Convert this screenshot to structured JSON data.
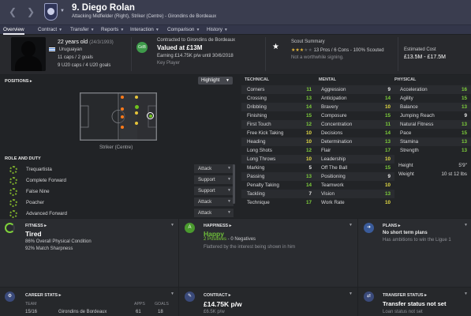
{
  "header": {
    "player_name": "9. Diego Rolan",
    "subtitle": "Attacking Midfielder (Right), Striker (Centre) - Girondins de Bordeaux"
  },
  "tabs": [
    {
      "label": "Overview",
      "active": true
    },
    {
      "label": "Contract"
    },
    {
      "label": "Transfer"
    },
    {
      "label": "Reports"
    },
    {
      "label": "Interaction"
    },
    {
      "label": "Comparison"
    },
    {
      "label": "History"
    }
  ],
  "info": {
    "age": "22 years old",
    "dob": "(24/3/1993)",
    "nationality": "Uruguayan",
    "caps": "11 caps / 2 goals",
    "u20": "9 U20 caps / 4 U20 goals",
    "club_badge_text": "GdB",
    "contracted": "Contracted to Girondins de Bordeaux",
    "valued": "Valued at £13M",
    "earning": "Earning £14.75K p/w until 30/6/2018",
    "status": "Key Player",
    "scout_title": "Scout Summary",
    "scout_stars_on": 3,
    "scout_stars_total": 5,
    "scout_detail": "13 Pros / 6 Cons - 100% Scouted",
    "scout_note": "Not a worthwhile signing.",
    "estimated_cost_label": "Estimated Cost",
    "estimated_cost": "£13.5M - £17.5M"
  },
  "positions": {
    "title": "POSITIONS",
    "highlight_label": "Highlight",
    "role_label": "Striker (Centre)"
  },
  "roles": {
    "title": "ROLE AND DUTY",
    "items": [
      {
        "name": "Trequartista",
        "duty": "Attack"
      },
      {
        "name": "Complete Forward",
        "duty": "Support"
      },
      {
        "name": "False Nine",
        "duty": "Support"
      },
      {
        "name": "Poacher",
        "duty": "Attack"
      },
      {
        "name": "Advanced Forward",
        "duty": "Attack"
      }
    ]
  },
  "attributes": {
    "technical_title": "TECHNICAL",
    "mental_title": "MENTAL",
    "physical_title": "PHYSICAL",
    "technical": [
      {
        "name": "Corners",
        "value": "11",
        "color": "green"
      },
      {
        "name": "Crossing",
        "value": "13",
        "color": "green"
      },
      {
        "name": "Dribbling",
        "value": "14",
        "color": "green"
      },
      {
        "name": "Finishing",
        "value": "15",
        "color": "green"
      },
      {
        "name": "First Touch",
        "value": "12",
        "color": "green"
      },
      {
        "name": "Free Kick Taking",
        "value": "10",
        "color": "yellow"
      },
      {
        "name": "Heading",
        "value": "10",
        "color": "yellow"
      },
      {
        "name": "Long Shots",
        "value": "12",
        "color": "green"
      },
      {
        "name": "Long Throws",
        "value": "10",
        "color": "yellow"
      },
      {
        "name": "Marking",
        "value": "5",
        "color": "white"
      },
      {
        "name": "Passing",
        "value": "13",
        "color": "green"
      },
      {
        "name": "Penalty Taking",
        "value": "14",
        "color": "green"
      },
      {
        "name": "Tackling",
        "value": "7",
        "color": "white"
      },
      {
        "name": "Technique",
        "value": "17",
        "color": "green"
      }
    ],
    "mental": [
      {
        "name": "Aggression",
        "value": "9",
        "color": "white"
      },
      {
        "name": "Anticipation",
        "value": "14",
        "color": "green"
      },
      {
        "name": "Bravery",
        "value": "10",
        "color": "yellow"
      },
      {
        "name": "Composure",
        "value": "15",
        "color": "green"
      },
      {
        "name": "Concentration",
        "value": "11",
        "color": "green"
      },
      {
        "name": "Decisions",
        "value": "14",
        "color": "green"
      },
      {
        "name": "Determination",
        "value": "13",
        "color": "green"
      },
      {
        "name": "Flair",
        "value": "17",
        "color": "green"
      },
      {
        "name": "Leadership",
        "value": "10",
        "color": "yellow"
      },
      {
        "name": "Off The Ball",
        "value": "15",
        "color": "green"
      },
      {
        "name": "Positioning",
        "value": "9",
        "color": "white"
      },
      {
        "name": "Teamwork",
        "value": "10",
        "color": "yellow"
      },
      {
        "name": "Vision",
        "value": "13",
        "color": "green"
      },
      {
        "name": "Work Rate",
        "value": "10",
        "color": "yellow"
      }
    ],
    "physical": [
      {
        "name": "Acceleration",
        "value": "16",
        "color": "green"
      },
      {
        "name": "Agility",
        "value": "15",
        "color": "green"
      },
      {
        "name": "Balance",
        "value": "13",
        "color": "green"
      },
      {
        "name": "Jumping Reach",
        "value": "9",
        "color": "white"
      },
      {
        "name": "Natural Fitness",
        "value": "13",
        "color": "green"
      },
      {
        "name": "Pace",
        "value": "15",
        "color": "green"
      },
      {
        "name": "Stamina",
        "value": "13",
        "color": "green"
      },
      {
        "name": "Strength",
        "value": "13",
        "color": "green"
      }
    ],
    "height_label": "Height",
    "height": "5'9\"",
    "weight_label": "Weight",
    "weight": "10 st 12 lbs"
  },
  "fitness": {
    "title": "FITNESS",
    "status": "Tired",
    "line1": "86% Overall Physical Condition",
    "line2": "92% Match Sharpness"
  },
  "happiness": {
    "title": "HAPPINESS",
    "icon": "A",
    "status": "Happy",
    "positives": "2 Positives",
    "negatives": "0 Negatives",
    "note": "Flattered by the interest being shown in him"
  },
  "plans": {
    "title": "PLANS",
    "status": "No short term plans",
    "note": "Has ambitions to win the Ligue 1"
  },
  "career": {
    "title": "CAREER STATS",
    "col_team": "TEAM",
    "col_apps": "APPS",
    "col_goals": "GOALS",
    "row_season": "15/16",
    "row_team": "Girondins de Bordeaux",
    "row_apps": "61",
    "row_goals": "18"
  },
  "contract": {
    "title": "CONTRACT",
    "wage": "£14.75K p/w",
    "sub": "£6.5K p/w"
  },
  "transfer": {
    "title": "TRANSFER STATUS",
    "status": "Transfer status not set",
    "sub": "Loan status not set"
  },
  "colors": {
    "green": "#7fd13b",
    "yellow": "#e5dc44",
    "white": "#e8e8e8",
    "header_bg": "#3a3d4f"
  }
}
